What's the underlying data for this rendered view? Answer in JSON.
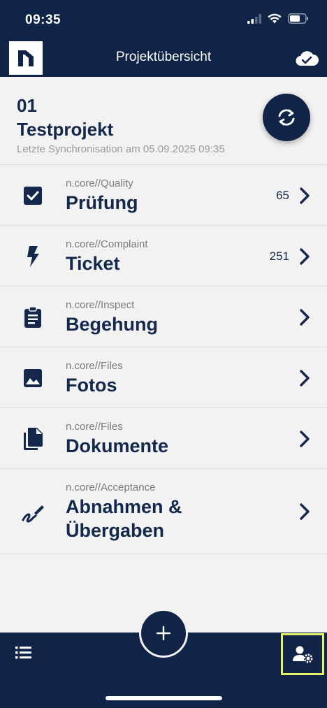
{
  "status_bar": {
    "time": "09:35"
  },
  "nav": {
    "title": "Projektübersicht",
    "logo_icon": "ncore-logo-icon",
    "cloud_icon": "cloud-check-icon"
  },
  "project": {
    "number": "01",
    "name": "Testprojekt",
    "sync_info": "Letzte Synchronisation am 05.09.2025 09:35"
  },
  "modules": [
    {
      "sub": "n.core//Quality",
      "title": "Prüfung",
      "count": "65",
      "icon": "checkbox-icon"
    },
    {
      "sub": "n.core//Complaint",
      "title": "Ticket",
      "count": "251",
      "icon": "lightning-icon"
    },
    {
      "sub": "n.core//Inspect",
      "title": "Begehung",
      "count": "",
      "icon": "clipboard-icon"
    },
    {
      "sub": "n.core//Files",
      "title": "Fotos",
      "count": "",
      "icon": "image-icon"
    },
    {
      "sub": "n.core//Files",
      "title": "Dokumente",
      "count": "",
      "icon": "documents-icon"
    },
    {
      "sub": "n.core//Acceptance",
      "title_line1": "Abnahmen &",
      "title_line2": "Übergaben",
      "count": "",
      "icon": "signature-icon"
    }
  ],
  "bottom_bar": {
    "list_icon": "list-icon",
    "add_icon": "plus-icon",
    "settings_icon": "user-settings-icon"
  },
  "colors": {
    "primary": "#0f2446",
    "background": "#f2f2f2",
    "highlight": "#e3f268"
  }
}
